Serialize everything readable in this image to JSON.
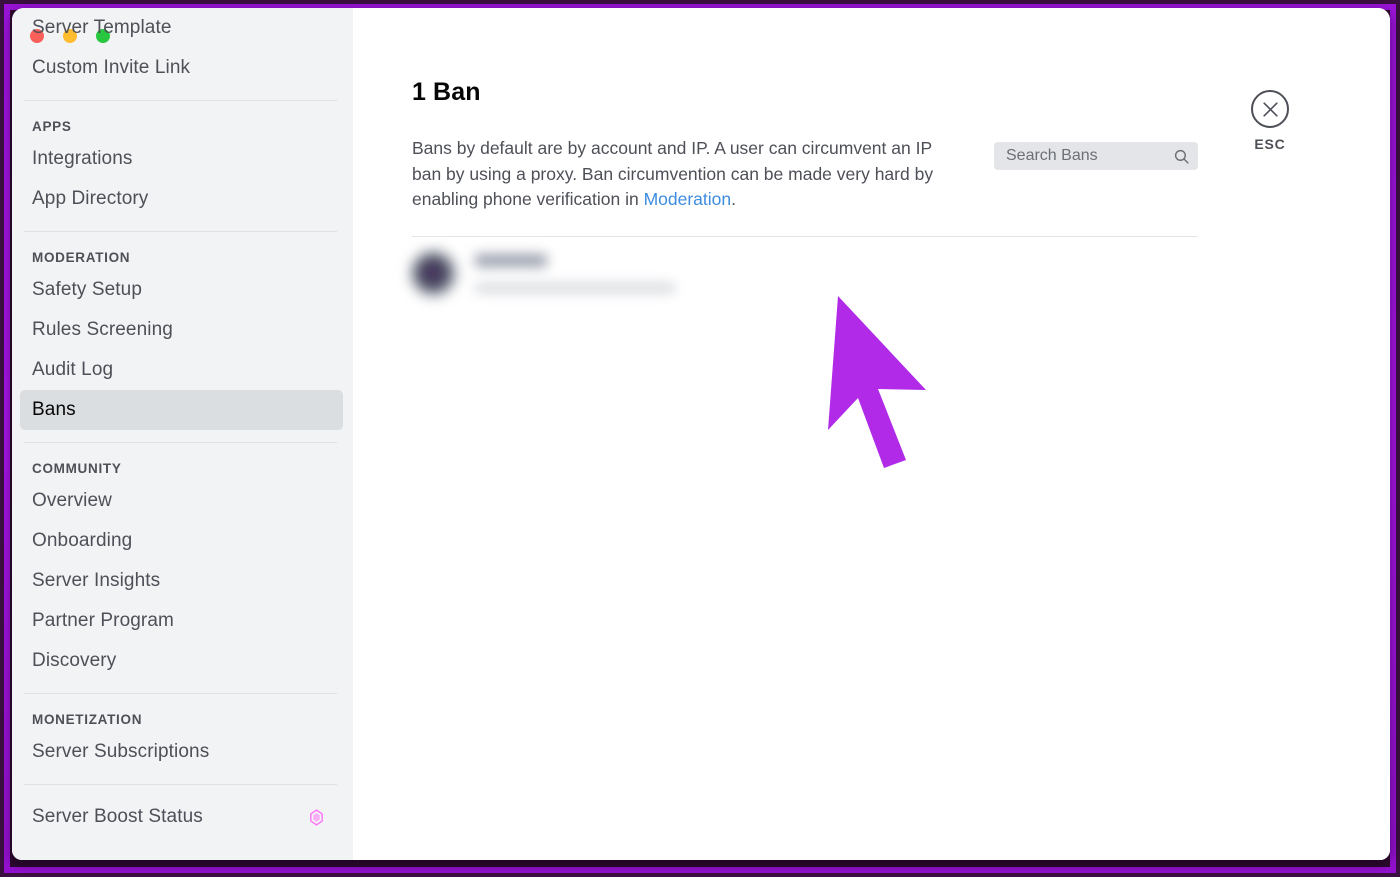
{
  "window": {
    "traffic_lights": [
      {
        "name": "close",
        "color": "#f9605a"
      },
      {
        "name": "minimize",
        "color": "#febc2e"
      },
      {
        "name": "maximize",
        "color": "#29c73f"
      }
    ]
  },
  "sidebar": {
    "items": [
      {
        "type": "item",
        "label": "Server Template",
        "active": false
      },
      {
        "type": "item",
        "label": "Custom Invite Link",
        "active": false
      },
      {
        "type": "sep"
      },
      {
        "type": "heading",
        "label": "APPS"
      },
      {
        "type": "item",
        "label": "Integrations",
        "active": false
      },
      {
        "type": "item",
        "label": "App Directory",
        "active": false
      },
      {
        "type": "sep"
      },
      {
        "type": "heading",
        "label": "MODERATION"
      },
      {
        "type": "item",
        "label": "Safety Setup",
        "active": false
      },
      {
        "type": "item",
        "label": "Rules Screening",
        "active": false
      },
      {
        "type": "item",
        "label": "Audit Log",
        "active": false
      },
      {
        "type": "item",
        "label": "Bans",
        "active": true
      },
      {
        "type": "sep"
      },
      {
        "type": "heading",
        "label": "COMMUNITY"
      },
      {
        "type": "item",
        "label": "Overview",
        "active": false
      },
      {
        "type": "item",
        "label": "Onboarding",
        "active": false
      },
      {
        "type": "item",
        "label": "Server Insights",
        "active": false
      },
      {
        "type": "item",
        "label": "Partner Program",
        "active": false
      },
      {
        "type": "item",
        "label": "Discovery",
        "active": false
      },
      {
        "type": "sep"
      },
      {
        "type": "heading",
        "label": "MONETIZATION"
      },
      {
        "type": "item",
        "label": "Server Subscriptions",
        "active": false
      },
      {
        "type": "sep"
      },
      {
        "type": "item",
        "label": "Server Boost Status",
        "active": false,
        "icon": "boost-gem-icon",
        "icon_color": "#ff73fa"
      }
    ],
    "scrollbar": {
      "name": "sidebar-scrollbar"
    }
  },
  "main": {
    "title": "1 Ban",
    "description": {
      "before_link": "Bans by default are by account and IP. A user can circumvent an IP ban by using a proxy. Ban circumvention can be made very hard by enabling phone verification in ",
      "link_text": "Moderation",
      "after_link": "."
    },
    "search": {
      "placeholder": "Search Bans",
      "value": "",
      "icon": "search-icon"
    },
    "close": {
      "icon": "close-x-icon",
      "label": "ESC"
    },
    "ban_list": [
      {
        "username": "",
        "reason": "",
        "blurred": true
      }
    ]
  },
  "colors": {
    "accent_link": "#3d8ce0",
    "frame_purple": "#a211e0",
    "frame_dark": "#3b0f3f",
    "sidebar_bg": "#f2f3f5",
    "active_item_bg": "#dbdee1",
    "cursor": "#b02ae8"
  }
}
